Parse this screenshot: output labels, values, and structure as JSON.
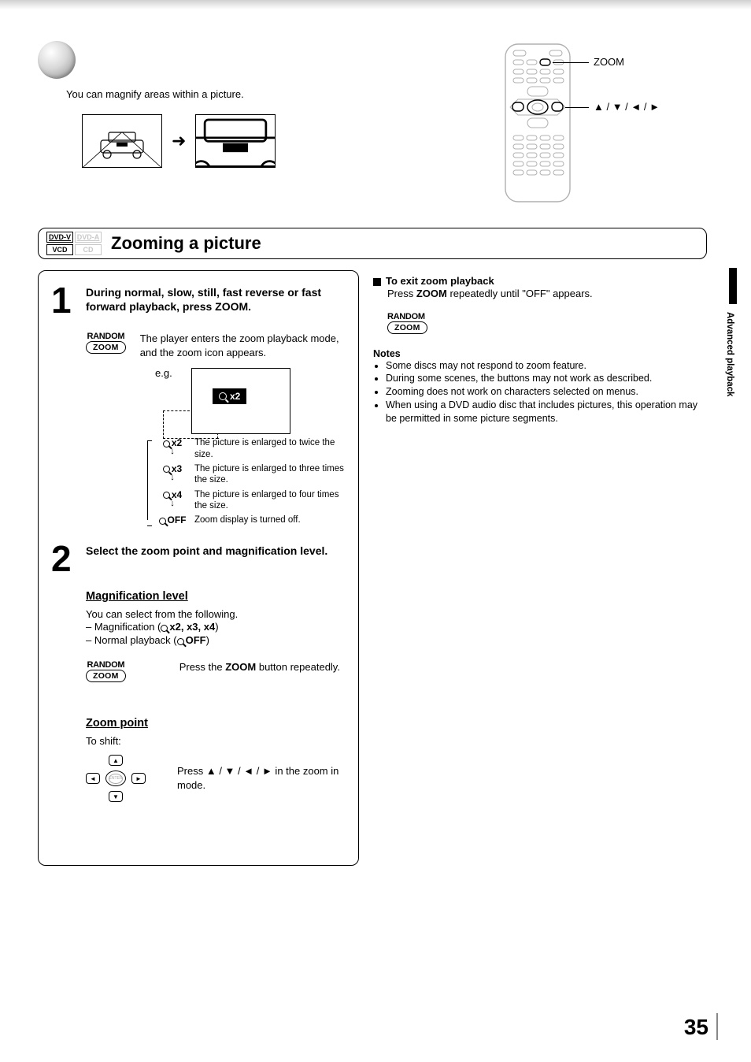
{
  "intro": "You can magnify areas within a picture.",
  "remote": {
    "label1": "ZOOM",
    "label2": "▲ / ▼ / ◄ / ►"
  },
  "section": {
    "badges": [
      "DVD-V",
      "DVD-A",
      "VCD",
      "CD"
    ],
    "title": "Zooming a picture"
  },
  "step1": {
    "num": "1",
    "title": "During normal, slow, still, fast reverse or fast forward playback, press ZOOM.",
    "random": "RANDOM",
    "zoom_btn": "ZOOM",
    "body": "The player enters the zoom playback mode, and the zoom icon appears.",
    "eg": "e.g.",
    "tag": "x2",
    "levels": [
      {
        "label": "x2",
        "desc": "The picture is enlarged to twice the size."
      },
      {
        "label": "x3",
        "desc": "The picture is enlarged to three times the size."
      },
      {
        "label": "x4",
        "desc": "The picture is enlarged to four times the size."
      },
      {
        "label": "OFF",
        "desc": "Zoom display is turned off."
      }
    ]
  },
  "step2": {
    "num": "2",
    "title": "Select the zoom point and magnification level.",
    "mag_heading": "Magnification level",
    "mag_intro": "You can select from the following.",
    "mag_line1a": "– Magnification (",
    "mag_line1b": "x2, x3, x4",
    "mag_line1c": ")",
    "mag_line2a": "– Normal playback (",
    "mag_line2b": "OFF",
    "mag_line2c": ")",
    "random": "RANDOM",
    "zoom_btn": "ZOOM",
    "press_zoom_a": "Press the ",
    "press_zoom_b": "ZOOM",
    "press_zoom_c": " button repeatedly.",
    "zoom_point_heading": "Zoom point",
    "to_shift": "To shift:",
    "press_dir": "Press ▲ / ▼ / ◄ / ► in the zoom in mode.",
    "enter": "ENTER"
  },
  "right": {
    "exit_title": "To exit zoom playback",
    "exit_body_a": "Press ",
    "exit_body_b": "ZOOM",
    "exit_body_c": " repeatedly until \"OFF\" appears.",
    "random": "RANDOM",
    "zoom_btn": "ZOOM",
    "notes_title": "Notes",
    "notes": [
      "Some discs may not respond to zoom feature.",
      "During some scenes, the buttons may not work as described.",
      "Zooming does not work on characters selected on menus.",
      "When using a DVD audio disc that includes pictures, this operation may be permitted in some picture segments."
    ]
  },
  "side_tab": "Advanced playback",
  "page_num": "35"
}
